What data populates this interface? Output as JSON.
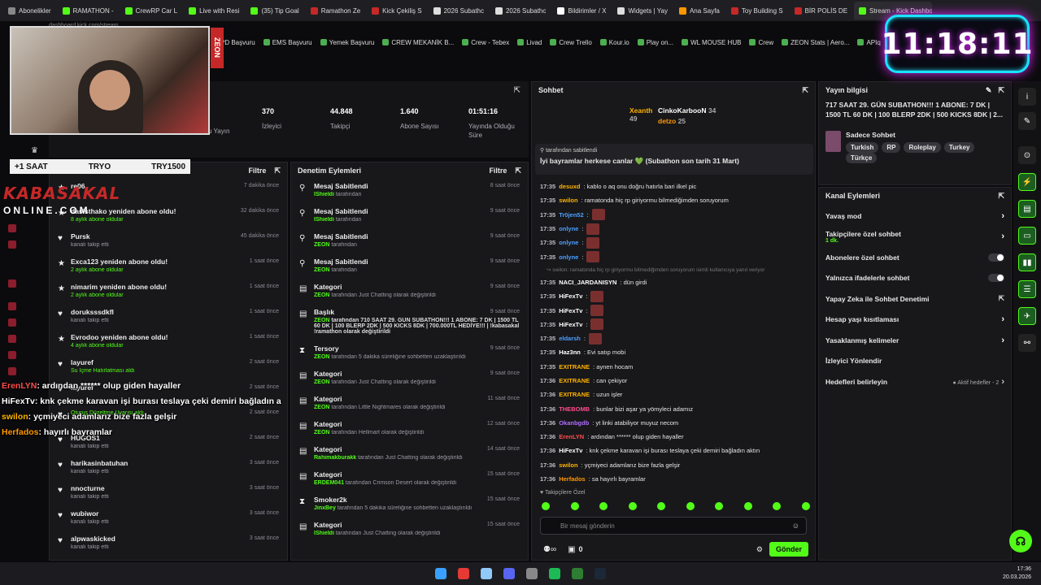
{
  "tabs": [
    {
      "label": "Abonelikler",
      "color": "#888"
    },
    {
      "label": "RAMATHON -",
      "color": "#53fc18"
    },
    {
      "label": "CrewRP Car L",
      "color": "#53fc18"
    },
    {
      "label": "Live with Resi",
      "color": "#53fc18"
    },
    {
      "label": "(35) Tip Goal",
      "color": "#53fc18"
    },
    {
      "label": "Ramathon Ze",
      "color": "#c62828"
    },
    {
      "label": "Kick Çekiliş S",
      "color": "#c62828"
    },
    {
      "label": "2026 Subathc",
      "color": "#ddd"
    },
    {
      "label": "2026 Subathc",
      "color": "#ddd"
    },
    {
      "label": "Bildirimler / X",
      "color": "#fff"
    },
    {
      "label": "Widgets | Yay",
      "color": "#ddd"
    },
    {
      "label": "Ana Sayfa",
      "color": "#ff9800"
    },
    {
      "label": "Toy Building S",
      "color": "#c62828"
    },
    {
      "label": "BİR POLİS DE",
      "color": "#c62828"
    },
    {
      "label": "Stream - Kick Dashboard",
      "color": "#53fc18",
      "active": true
    }
  ],
  "address": "dashboard.kick.com/stream",
  "bookmarks": [
    "PD Başvuru",
    "EMS Başvuru",
    "Yemek Başvuru",
    "CREW MEKANİK B...",
    "Crew - Tebex",
    "Livad",
    "Crew Trello",
    "Kour.io",
    "Play on...",
    "WL MOUSE HUB",
    "Crew",
    "ZEON Stats | Aero...",
    "APIq"
  ],
  "clock": "11:18:11",
  "overlay": {
    "zeon_badge": "ZEON",
    "sub_label": "+1 SAAT",
    "sub_mid": "TRYO",
    "sub_right": "TRY1500",
    "brand": "KABASAKAL",
    "brand2": "ONLINE.COM",
    "chat": [
      {
        "user": "ErenLYN",
        "text": ": ardından ****** olup giden hayaller",
        "color": "#ff4d4d"
      },
      {
        "user": "HiFexTv",
        "text": ": knk çekme karavan işi burası teslaya çeki demiri bağladın a",
        "color": "#ffffff"
      },
      {
        "user": "swilon",
        "text": ": yçmiyeci adamlarız bize fazla gelşir",
        "color": "#ffb300"
      },
      {
        "user": "Herfados",
        "text": ": hayırlı bayramlar",
        "color": "#ff9800"
      }
    ]
  },
  "stats": {
    "items": [
      {
        "value": "",
        "label": "Programı"
      },
      {
        "value": "",
        "label": "u Yayın"
      },
      {
        "value": "370",
        "label": "İzleyici"
      },
      {
        "value": "44.848",
        "label": "Takipçi"
      },
      {
        "value": "1.640",
        "label": "Abone Sayısı"
      },
      {
        "value": "01:51:16",
        "label": "Yayında Olduğu Süre"
      }
    ]
  },
  "activity": {
    "filter": "Filtre",
    "items": [
      {
        "icon": "★",
        "title": "re06",
        "sub": "",
        "time": "7 dakika önce"
      },
      {
        "icon": "★",
        "title": "dasisthako yeniden abone oldu!",
        "sub": "8 aylık abone oldular",
        "time": "32 dakika önce"
      },
      {
        "icon": "♥",
        "title": "Pursk",
        "sub": "kanalı takip etti",
        "time": "45 dakika önce"
      },
      {
        "icon": "★",
        "title": "Exca123 yeniden abone oldu!",
        "sub": "2 aylık abone oldular",
        "time": "1 saat önce"
      },
      {
        "icon": "★",
        "title": "nimarim yeniden abone oldu!",
        "sub": "2 aylık abone oldular",
        "time": "1 saat önce"
      },
      {
        "icon": "♥",
        "title": "doruksssdkfl",
        "sub": "kanalı takip etti",
        "time": "1 saat önce"
      },
      {
        "icon": "★",
        "title": "Evrodoo yeniden abone oldu!",
        "sub": "4 aylık abone oldular",
        "time": "1 saat önce"
      },
      {
        "icon": "♥",
        "title": "layuref",
        "sub": "Su İçme Hatırlatması aldı",
        "time": "2 saat önce"
      },
      {
        "icon": "♥",
        "title": "layuref",
        "sub": "",
        "time": "2 saat önce"
      },
      {
        "icon": "♥",
        "title": "",
        "sub": "Oturuş Düzeltme Uyarısı aldı",
        "time": "2 saat önce"
      },
      {
        "icon": "♥",
        "title": "HUGOS1",
        "sub": "kanalı takip etti",
        "time": "2 saat önce"
      },
      {
        "icon": "♥",
        "title": "harikasinbatuhan",
        "sub": "kanalı takip etti",
        "time": "3 saat önce"
      },
      {
        "icon": "♥",
        "title": "nnocturne",
        "sub": "kanalı takip etti",
        "time": "3 saat önce"
      },
      {
        "icon": "♥",
        "title": "wubiwor",
        "sub": "kanalı takip etti",
        "time": "3 saat önce"
      },
      {
        "icon": "♥",
        "title": "alpwaskicked",
        "sub": "kanalı takip etti",
        "time": "3 saat önce"
      }
    ]
  },
  "moderation": {
    "title": "Denetim Eylemleri",
    "filter": "Filtre",
    "items": [
      {
        "icon": "⚲",
        "title": "Mesaj Sabitlendi",
        "actor": "IShieldi",
        "rest": "tarafından",
        "time": "8 saat önce"
      },
      {
        "icon": "⚲",
        "title": "Mesaj Sabitlendi",
        "actor": "IShieldi",
        "rest": "tarafından",
        "time": "9 saat önce"
      },
      {
        "icon": "⚲",
        "title": "Mesaj Sabitlendi",
        "actor": "ZEON",
        "rest": "tarafından",
        "time": "9 saat önce"
      },
      {
        "icon": "⚲",
        "title": "Mesaj Sabitlendi",
        "actor": "ZEON",
        "rest": "tarafından",
        "time": "9 saat önce"
      },
      {
        "icon": "▤",
        "title": "Kategori",
        "actor": "ZEON",
        "rest": "tarafından Just Chatting olarak değiştirildi",
        "time": "9 saat önce"
      },
      {
        "icon": "▤",
        "title": "Başlık",
        "actor": "ZEON",
        "rest": "tarafından 710 SAAT 29. GÜN SUBATHON!!! 1 ABONE: 7 DK | 1500 TL 60 DK | 100 BLERP 2DK | 500 KICKS 8DK | 700.000TL HEDİYE!!! | !kabasakal !ramathon olarak değiştirildi",
        "time": "9 saat önce"
      },
      {
        "icon": "⧗",
        "title": "Tersory",
        "actor": "ZEON",
        "rest": "tarafından 5 dakika süreliğine sohbetten uzaklaştırıldı",
        "time": "9 saat önce"
      },
      {
        "icon": "▤",
        "title": "Kategori",
        "actor": "ZEON",
        "rest": "tarafından Just Chatting olarak değiştirildi",
        "time": "9 saat önce"
      },
      {
        "icon": "▤",
        "title": "Kategori",
        "actor": "ZEON",
        "rest": "tarafından Little Nightmares olarak değiştirildi",
        "time": "11 saat önce"
      },
      {
        "icon": "▤",
        "title": "Kategori",
        "actor": "ZEON",
        "rest": "tarafından Hellmart olarak değiştirildi",
        "time": "12 saat önce"
      },
      {
        "icon": "▤",
        "title": "Kategori",
        "actor": "Rahimakburakk",
        "rest": "tarafından Just Chatting olarak değiştirildi",
        "time": "14 saat önce"
      },
      {
        "icon": "▤",
        "title": "Kategori",
        "actor": "ERDEM041",
        "rest": "tarafından Crimson Desert olarak değiştirildi",
        "time": "15 saat önce"
      },
      {
        "icon": "⧗",
        "title": "Smoker2k",
        "actor": "JinxBey",
        "rest": "tarafından 5 dakika süreliğine sohbetten uzaklaştırıldı",
        "time": "15 saat önce"
      },
      {
        "icon": "▤",
        "title": "Kategori",
        "actor": "IShieldi",
        "rest": "tarafından Just Chatting olarak değiştirildi",
        "time": "15 saat önce"
      }
    ]
  },
  "chat": {
    "title": "Sohbet",
    "top": [
      {
        "name": "Xeanth",
        "count": "49",
        "color": "#ffb300"
      },
      {
        "name": "CinkoKarbooN",
        "count": "34",
        "color": "#fff"
      },
      {
        "name": "detzo",
        "count": "25",
        "color": "#ff9800"
      }
    ],
    "pinned_by": "tarafından sabitlendi",
    "pinned_text": "İyi bayramlar herkese canlar 💚 (Subathon son tarih 31 Mart)",
    "messages": [
      {
        "time": "17:35",
        "user": "desuxd",
        "color": "#ffb300",
        "text": ": kablo o aq onu doğru hatırla bari ilkel pic"
      },
      {
        "time": "17:35",
        "user": "swilon",
        "color": "#ffb300",
        "text": ": ramatonda hiç rp giriyormu bilmediğimden soruyorum"
      },
      {
        "time": "17:35",
        "user": "Tr0jen52",
        "color": "#4d9fff",
        "text": ":",
        "emote": true
      },
      {
        "time": "17:35",
        "user": "onlyne",
        "color": "#4d9fff",
        "text": ":",
        "emote": true
      },
      {
        "time": "17:35",
        "user": "onlyne",
        "color": "#4d9fff",
        "text": ":",
        "emote": true
      },
      {
        "time": "17:35",
        "user": "onlyne",
        "color": "#4d9fff",
        "text": ":",
        "emote": true
      },
      {
        "time": "",
        "user": "",
        "color": "#777",
        "text": "↪ swilon: ramatonda hiç rp giriyormu bilmediğimden soruyorum isimli kullanıcıya yanıt veriyor"
      },
      {
        "time": "17:35",
        "user": "NACI_JARDANISYN",
        "color": "#fff",
        "text": ": dün girdi"
      },
      {
        "time": "17:35",
        "user": "HiFexTv",
        "color": "#fff",
        "text": ":",
        "emote": true
      },
      {
        "time": "17:35",
        "user": "HiFexTv",
        "color": "#fff",
        "text": ":",
        "emote": true
      },
      {
        "time": "17:35",
        "user": "HiFexTv",
        "color": "#fff",
        "text": ":",
        "emote": true
      },
      {
        "time": "17:35",
        "user": "eldarsh",
        "color": "#4d9fff",
        "text": ":",
        "emote": true
      },
      {
        "time": "17:35",
        "user": "Haz3nn",
        "color": "#fff",
        "text": ": Evi satıp mobi"
      },
      {
        "time": "17:35",
        "user": "EXITRANE",
        "color": "#ffb300",
        "text": ": aynen hocam"
      },
      {
        "time": "17:36",
        "user": "EXITRANE",
        "color": "#ffb300",
        "text": ": can çekiyor"
      },
      {
        "time": "17:36",
        "user": "EXITRANE",
        "color": "#ffb300",
        "text": ": uzun işler"
      },
      {
        "time": "17:36",
        "user": "THEBOMB",
        "color": "#ff4d8a",
        "text": ": bunlar bizi aşar ya yömyleci adamız"
      },
      {
        "time": "17:36",
        "user": "Okanbgdb",
        "color": "#b06bff",
        "text": ": yt linki atabiliyor muyuz necom"
      },
      {
        "time": "17:36",
        "user": "ErenLYN",
        "color": "#ff4d4d",
        "text": ": ardından ****** olup giden hayaller"
      },
      {
        "time": "17:36",
        "user": "HiFexTv",
        "color": "#fff",
        "text": ": knk çekme karavan işi burası teslaya çeki demiri bağladın aktın"
      },
      {
        "time": "17:36",
        "user": "swilon",
        "color": "#ffb300",
        "text": ": yçmiyeci adamlarız bize fazla gelşir"
      },
      {
        "time": "17:36",
        "user": "Herfados",
        "color": "#ff9800",
        "text": ": sa hayırlı bayramlar"
      }
    ],
    "followers_only": "Takipçilere Özel",
    "placeholder": "Bir mesaj gönderin",
    "points": "0",
    "send": "Gönder"
  },
  "info": {
    "title": "Yayın bilgisi",
    "stream_title": "717 SAAT 29. GÜN SUBATHON!!! 1 ABONE: 7 DK | 1500 TL 60 DK | 100 BLERP 2DK | 500 KICKS 8DK | 2...",
    "category": "Sadece Sohbet",
    "tags": [
      "Turkish",
      "RP",
      "Roleplay",
      "Turkey",
      "Türkçe"
    ]
  },
  "actions": {
    "title": "Kanal Eylemleri",
    "rows": [
      {
        "label": "Yavaş mod",
        "sub": "",
        "ctrl": "chev"
      },
      {
        "label": "Takipçilere özel sohbet",
        "sub": "1 dk.",
        "ctrl": "chev"
      },
      {
        "label": "Abonelere özel sohbet",
        "sub": "",
        "ctrl": "toggle"
      },
      {
        "label": "Yalnızca ifadelerle sohbet",
        "sub": "",
        "ctrl": "toggle"
      },
      {
        "label": "Yapay Zeka ile Sohbet Denetimi",
        "sub": "",
        "ctrl": "ext"
      },
      {
        "label": "Hesap yaşı kısıtlaması",
        "sub": "",
        "ctrl": "chev"
      },
      {
        "label": "Yasaklanmış kelimeler",
        "sub": "",
        "ctrl": "chev"
      },
      {
        "label": "İzleyici Yönlendir",
        "sub": "",
        "ctrl": "none"
      },
      {
        "label": "Hedefleri belirleyin",
        "sub": "",
        "ctrl": "goal",
        "extra": "● Aktif hedefler - 2"
      }
    ]
  },
  "taskbar": {
    "time": "17:36",
    "date": "20.03.2026"
  }
}
